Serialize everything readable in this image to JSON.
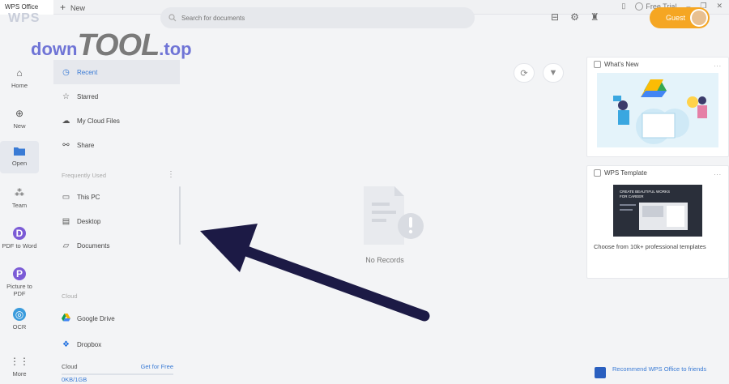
{
  "titlebar": {
    "app_name": "WPS Office",
    "new_tab_label": "New",
    "free_trial_label": "Free Trial"
  },
  "header": {
    "logo": "WPS",
    "search_placeholder": "Search for documents",
    "guest_label": "Guest"
  },
  "watermark": {
    "part1": "down",
    "part2": "TOOL",
    "part3": ".top"
  },
  "rail": [
    {
      "label": "Home",
      "icon": "home-icon"
    },
    {
      "label": "New",
      "icon": "plus-circle-icon"
    },
    {
      "label": "Open",
      "icon": "folder-icon",
      "active": true
    },
    {
      "label": "Team",
      "icon": "team-icon"
    },
    {
      "label": "PDF to Word",
      "icon": "pdf-to-word-icon",
      "letter": "D"
    },
    {
      "label": "Picture to PDF",
      "icon": "picture-to-pdf-icon",
      "letter": "P"
    },
    {
      "label": "OCR",
      "icon": "ocr-icon"
    },
    {
      "label": "More",
      "icon": "grid-icon"
    }
  ],
  "nav": {
    "items": [
      {
        "label": "Recent",
        "icon": "clock-icon",
        "active": true
      },
      {
        "label": "Starred",
        "icon": "star-icon"
      },
      {
        "label": "My Cloud Files",
        "icon": "cloud-icon"
      },
      {
        "label": "Share",
        "icon": "share-icon"
      }
    ],
    "frequently_used_label": "Frequently Used",
    "frequent": [
      {
        "label": "This PC",
        "icon": "monitor-icon"
      },
      {
        "label": "Desktop",
        "icon": "desktop-icon"
      },
      {
        "label": "Documents",
        "icon": "folder-outline-icon"
      }
    ],
    "cloud_label": "Cloud",
    "cloud": [
      {
        "label": "Google Drive",
        "icon": "google-drive-icon"
      },
      {
        "label": "Dropbox",
        "icon": "dropbox-icon"
      }
    ],
    "cloud_footer": {
      "label": "Cloud",
      "link": "Get for Free",
      "usage": "0KB/1GB"
    }
  },
  "main": {
    "empty_text": "No Records"
  },
  "cards": {
    "whats_new": {
      "title": "What's New",
      "more": "..."
    },
    "template": {
      "title": "WPS Template",
      "more": "...",
      "banner_text": "CREATE BEAUTIFUL WORKS\nFOR CAREER",
      "caption": "Choose from 10k+ professional templates"
    },
    "recommend": "Recommend WPS Office to friends"
  },
  "colors": {
    "accent": "#3a7bd5",
    "guest": "#f5a623",
    "arrow": "#1c1a45"
  }
}
